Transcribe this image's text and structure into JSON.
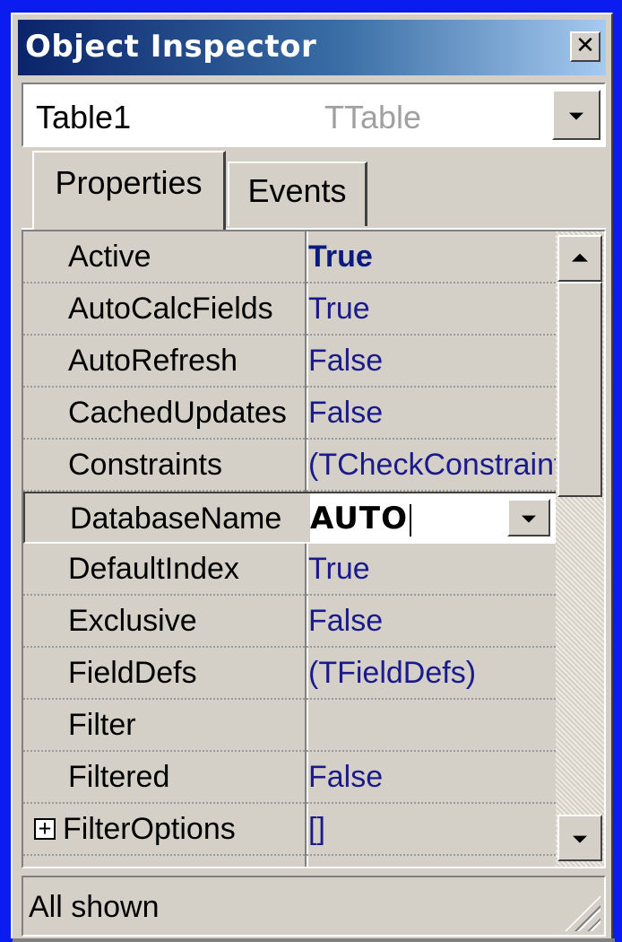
{
  "window": {
    "title": "Object Inspector",
    "close_symbol": "✕"
  },
  "object_selector": {
    "name": "Table1",
    "type": "TTable"
  },
  "tabs": [
    {
      "label": "Properties",
      "active": true
    },
    {
      "label": "Events",
      "active": false
    }
  ],
  "properties": [
    {
      "name": "Active",
      "value": "True",
      "bold": true
    },
    {
      "name": "AutoCalcFields",
      "value": "True"
    },
    {
      "name": "AutoRefresh",
      "value": "False"
    },
    {
      "name": "CachedUpdates",
      "value": "False"
    },
    {
      "name": "Constraints",
      "value": "(TCheckConstraints)"
    },
    {
      "name": "DatabaseName",
      "value": "AUTO",
      "selected": true
    },
    {
      "name": "DefaultIndex",
      "value": "True"
    },
    {
      "name": "Exclusive",
      "value": "False"
    },
    {
      "name": "FieldDefs",
      "value": "(TFieldDefs)"
    },
    {
      "name": "Filter",
      "value": ""
    },
    {
      "name": "Filtered",
      "value": "False"
    },
    {
      "name": "FilterOptions",
      "value": "[]",
      "expandable": true,
      "expand_symbol": "+"
    }
  ],
  "status": {
    "text": "All shown"
  },
  "colors": {
    "desktop": "#0a1cf0",
    "title_gradient_start": "#0a246a",
    "title_gradient_end": "#a6caf0",
    "value_text": "#1a1a8c",
    "face": "#d4d0c8"
  }
}
